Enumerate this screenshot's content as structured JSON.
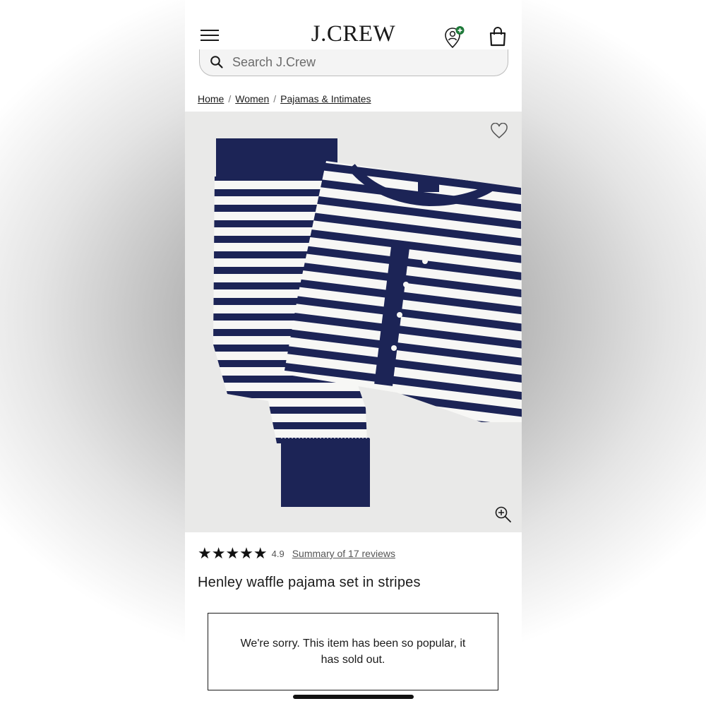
{
  "header": {
    "logo": "J.CREW",
    "menu_icon": "hamburger-menu-icon",
    "account_icon": "account-location-icon",
    "bag_icon": "shopping-bag-icon",
    "accent_color": "#1f7a3a"
  },
  "search": {
    "placeholder": "Search J.Crew",
    "icon": "search-icon"
  },
  "breadcrumb": {
    "items": [
      "Home",
      "Women",
      "Pajamas & Intimates"
    ],
    "separator": "/"
  },
  "product": {
    "image_alt": "Henley waffle pajama set in navy and white stripes",
    "favorite_icon": "heart-icon",
    "zoom_icon": "zoom-in-icon",
    "stars": "★★★★★",
    "rating": "4.9",
    "reviews_link": "Summary of 17 reviews",
    "title": "Henley waffle pajama set in stripes",
    "stripe_colors": {
      "navy": "#1c2456",
      "white": "#f7f7f5"
    }
  },
  "notice": {
    "sold_out_message": "We're sorry. This item has been so popular, it has sold out."
  }
}
